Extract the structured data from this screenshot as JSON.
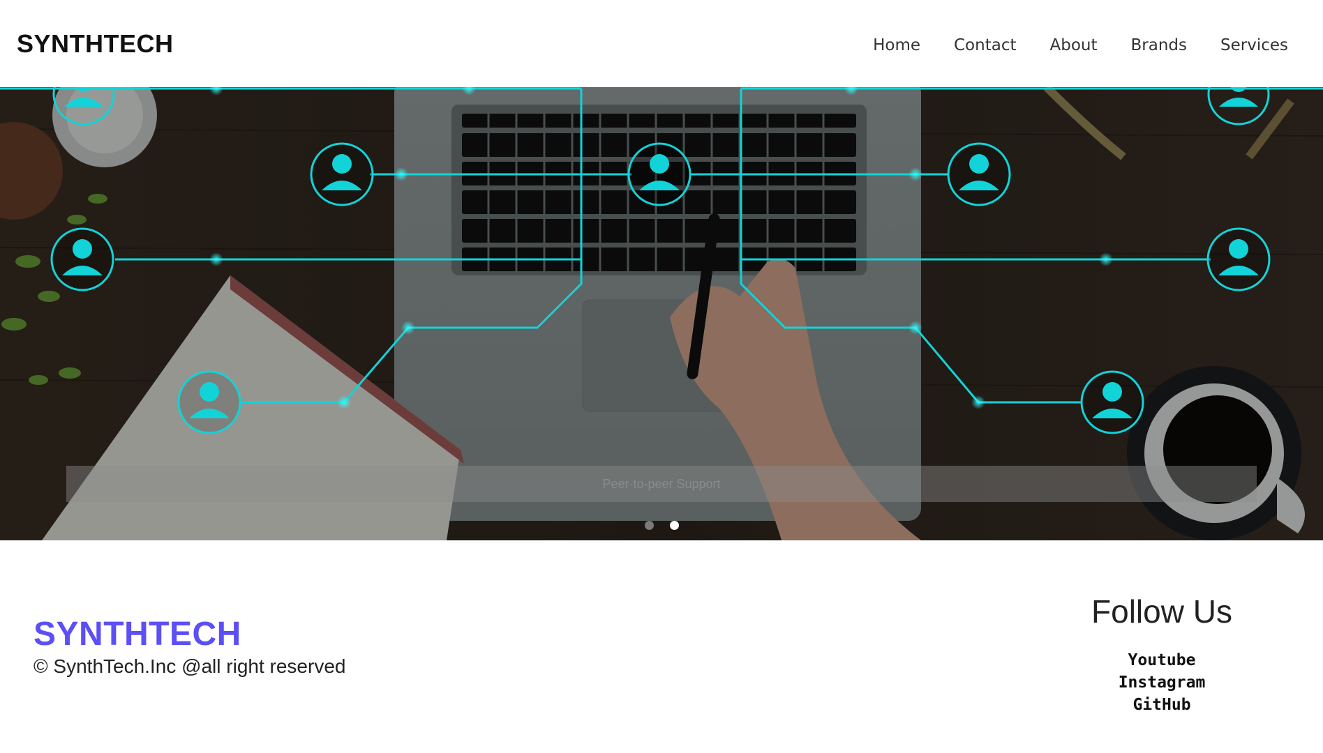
{
  "header": {
    "brand": "SYNTHTECH",
    "nav": [
      "Home",
      "Contact",
      "About",
      "Brands",
      "Services"
    ]
  },
  "hero": {
    "caption": "Peer-to-peer Support",
    "slide_count": 2,
    "active_slide": 2,
    "accent_color": "#12d3d8"
  },
  "footer": {
    "brand": "SYNTHTECH",
    "brand_color": "#5b4ff5",
    "copyright": "© SynthTech.Inc @all right reserved",
    "follow_title": "Follow Us",
    "social": [
      "Youtube",
      "Instagram",
      "GitHub"
    ]
  }
}
